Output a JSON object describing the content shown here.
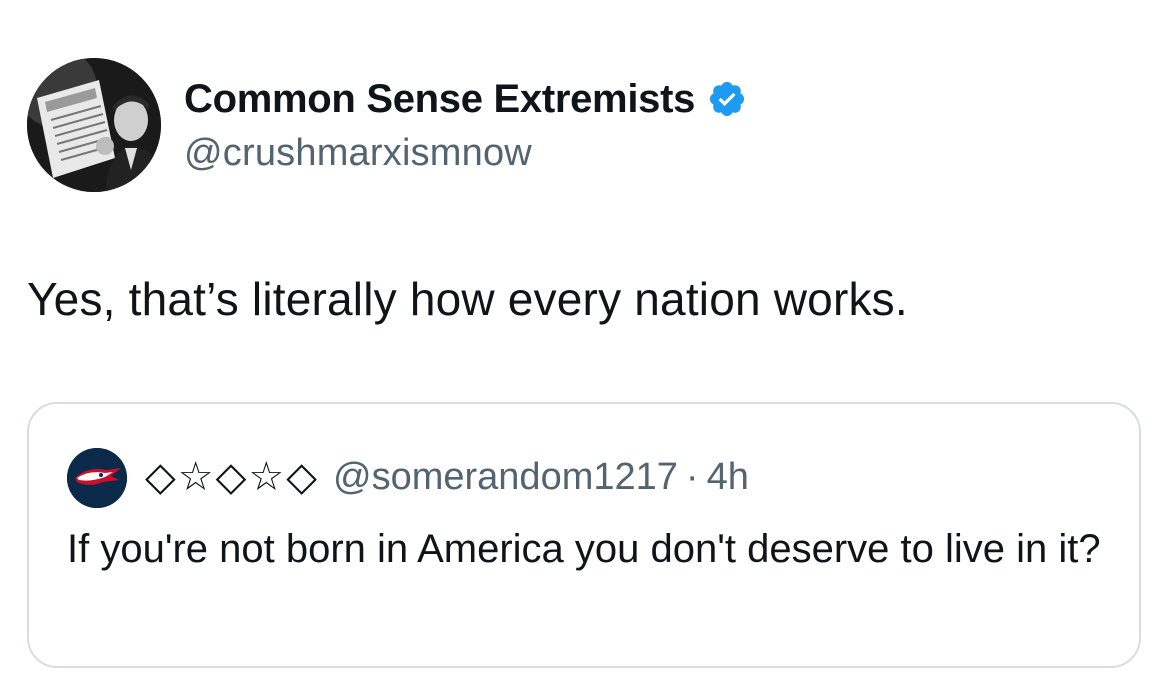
{
  "tweet": {
    "author": {
      "name": "Common Sense Extremists",
      "handle": "@crushmarxismnow",
      "verified": true,
      "avatar_icon": "newspaper-man-photo-avatar"
    },
    "text": "Yes, that’s literally how every nation works."
  },
  "quoted_tweet": {
    "author": {
      "display_name": "◇☆◇☆◇",
      "handle": "@somerandom1217",
      "avatar_icon": "patriots-logo-avatar"
    },
    "separator": "·",
    "time": "4h",
    "text": "If you're not born in America you don't deserve to live in it?"
  },
  "colors": {
    "text_primary": "#0f1419",
    "text_secondary": "#536471",
    "verified_blue": "#1d9bf0",
    "card_border": "#d9dde1"
  }
}
